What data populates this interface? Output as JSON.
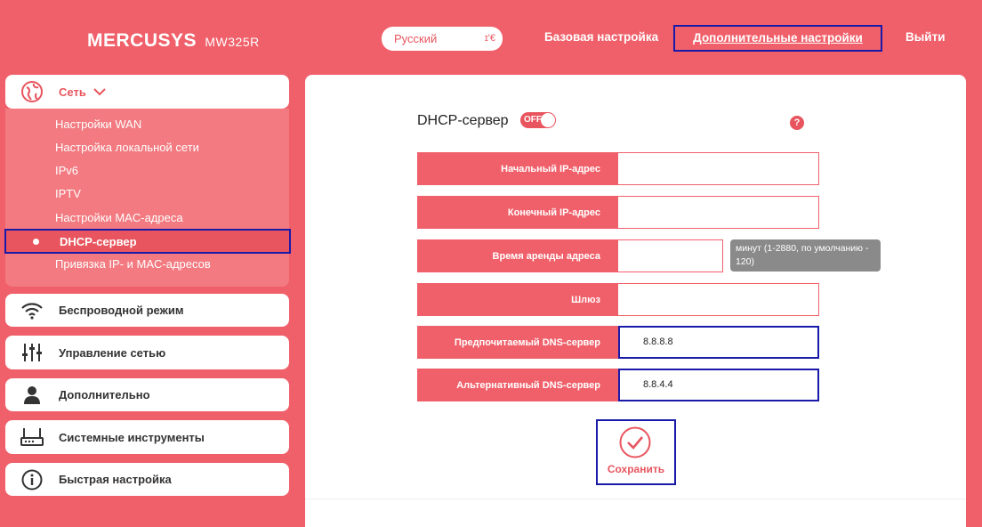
{
  "header": {
    "brand": "MERCUSYS",
    "model": "MW325R",
    "language": "Русский",
    "nav_basic": "Базовая настройка",
    "nav_advanced": "Дополнительные настройки",
    "nav_logout": "Выйти"
  },
  "sidebar": {
    "network_label": "Сеть",
    "submenu": [
      "Настройки WAN",
      "Настройка локальной сети",
      "IPv6",
      "IPTV",
      "Настройки MAC-адреса",
      "DHCP-сервер",
      "Привязка IP- и MAC-адресов"
    ],
    "wireless": "Беспроводной режим",
    "network_control": "Управление сетью",
    "advanced": "Дополнительно",
    "system_tools": "Системные инструменты",
    "quick_setup": "Быстрая настройка"
  },
  "main": {
    "title": "DHCP-сервер",
    "toggle_state": "OFF",
    "help": "?",
    "fields": {
      "start_ip_label": "Начальный IP-адрес",
      "start_ip_value": "",
      "end_ip_label": "Конечный IP-адрес",
      "end_ip_value": "",
      "lease_label": "Время аренды адреса",
      "lease_value": "",
      "lease_hint": "минут (1-2880, по умолчанию - 120)",
      "gateway_label": "Шлюз",
      "gateway_value": "",
      "dns1_label": "Предпочитаемый DNS-сервер",
      "dns1_value": "8.8.8.8",
      "dns2_label": "Альтернативный DNS-сервер",
      "dns2_value": "8.8.4.4"
    },
    "save_label": "Сохранить"
  },
  "colors": {
    "brand_red": "#f0606a",
    "highlight_blue": "#1a1aa8"
  }
}
